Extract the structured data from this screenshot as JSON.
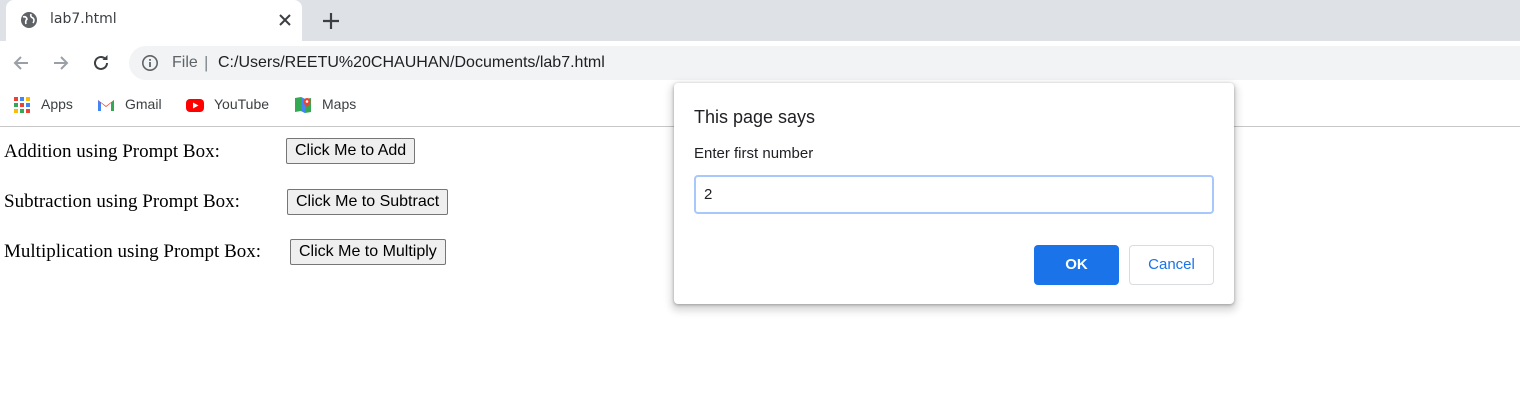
{
  "browser": {
    "tab": {
      "title": "lab7.html",
      "icon": "globe-icon",
      "close_icon": "close-icon"
    },
    "new_tab_icon": "plus-icon",
    "nav": {
      "back_icon": "back-arrow-icon",
      "forward_icon": "forward-arrow-icon",
      "reload_icon": "reload-icon"
    },
    "address_bar": {
      "info_icon": "info-icon",
      "scheme": "File",
      "separator": "|",
      "url": "C:/Users/REETU%20CHAUHAN/Documents/lab7.html"
    },
    "bookmarks": [
      {
        "label": "Apps",
        "icon": "apps-grid-icon"
      },
      {
        "label": "Gmail",
        "icon": "gmail-icon"
      },
      {
        "label": "YouTube",
        "icon": "youtube-icon"
      },
      {
        "label": "Maps",
        "icon": "maps-icon"
      }
    ]
  },
  "page": {
    "rows": [
      {
        "label": "Addition using Prompt Box:",
        "button": "Click Me to Add"
      },
      {
        "label": "Subtraction using Prompt Box:",
        "button": "Click Me to Subtract"
      },
      {
        "label": "Multiplication using Prompt Box:",
        "button": "Click Me to Multiply"
      }
    ]
  },
  "dialog": {
    "title": "This page says",
    "message": "Enter first number",
    "input_value": "2",
    "ok_label": "OK",
    "cancel_label": "Cancel"
  },
  "colors": {
    "accent": "#1a73e8",
    "tabstrip": "#dee1e6",
    "omnibox": "#f1f3f4",
    "focus_ring": "#a8c7fa"
  }
}
